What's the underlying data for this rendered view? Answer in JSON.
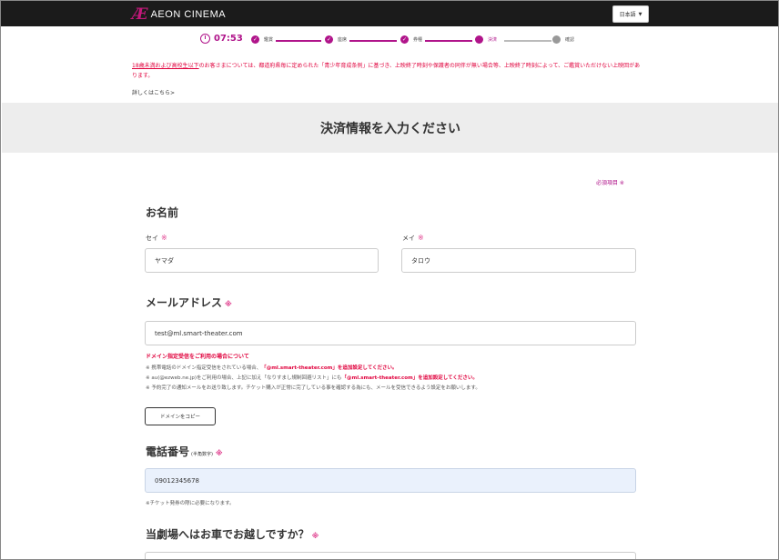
{
  "header": {
    "logo_mark": "Æ",
    "logo_text": "AEON CINEMA",
    "language": "日本語"
  },
  "progress": {
    "timer": "07:53",
    "steps": [
      "鑑賞",
      "座席",
      "券種",
      "決済",
      "確認"
    ],
    "current_step_index": 3
  },
  "notice": {
    "highlight": "18歳未満および高校生以下",
    "text": "のお客さまについては、都道府県毎に定められた「青少年育成条例」に基づき、上映終了時刻や保護者の同伴が無い場合等、上映終了時刻によって、ご鑑賞いただけない上映回があります。",
    "detail_link": "詳しくはこちら>"
  },
  "page_title": "決済情報を入力ください",
  "required_note": "必須項目 ※",
  "name_section": {
    "title": "お名前",
    "sei_label": "セイ",
    "sei_value": "ヤマダ",
    "mei_label": "メイ",
    "mei_value": "タロウ"
  },
  "email_section": {
    "title": "メールアドレス",
    "value": "test@ml.smart-theater.com",
    "warn_title": "ドメイン指定受信をご利用の場合について",
    "note1_a": "※ 携帯電話のドメイン指定受信をされている場合、",
    "note1_b": "「@ml.smart-theater.com」を追加設定してください。",
    "note2_a": "※ au(@ezweb.ne.jp)をご利用の場合、上記に加え「なりすまし規制回避リスト」にも",
    "note2_b": "「@ml.smart-theater.com」を追加設定してください。",
    "note3": "※ 予約完了の通知メールをお送り致します。チケット購入が正常に完了している事を確認する為にも、メールを受信できるよう設定をお願いします。",
    "copy_button": "ドメインをコピー"
  },
  "phone_section": {
    "title": "電話番号",
    "sub": "(半角数字)",
    "value": "09012345678",
    "note": "※チケット発券の際に必要になります。"
  },
  "car_section": {
    "title": "当劇場へはお車でお越しですか？"
  },
  "colors": {
    "brand": "#b0148a",
    "header_bg": "#1b1b1b",
    "warning": "#e0003c"
  }
}
